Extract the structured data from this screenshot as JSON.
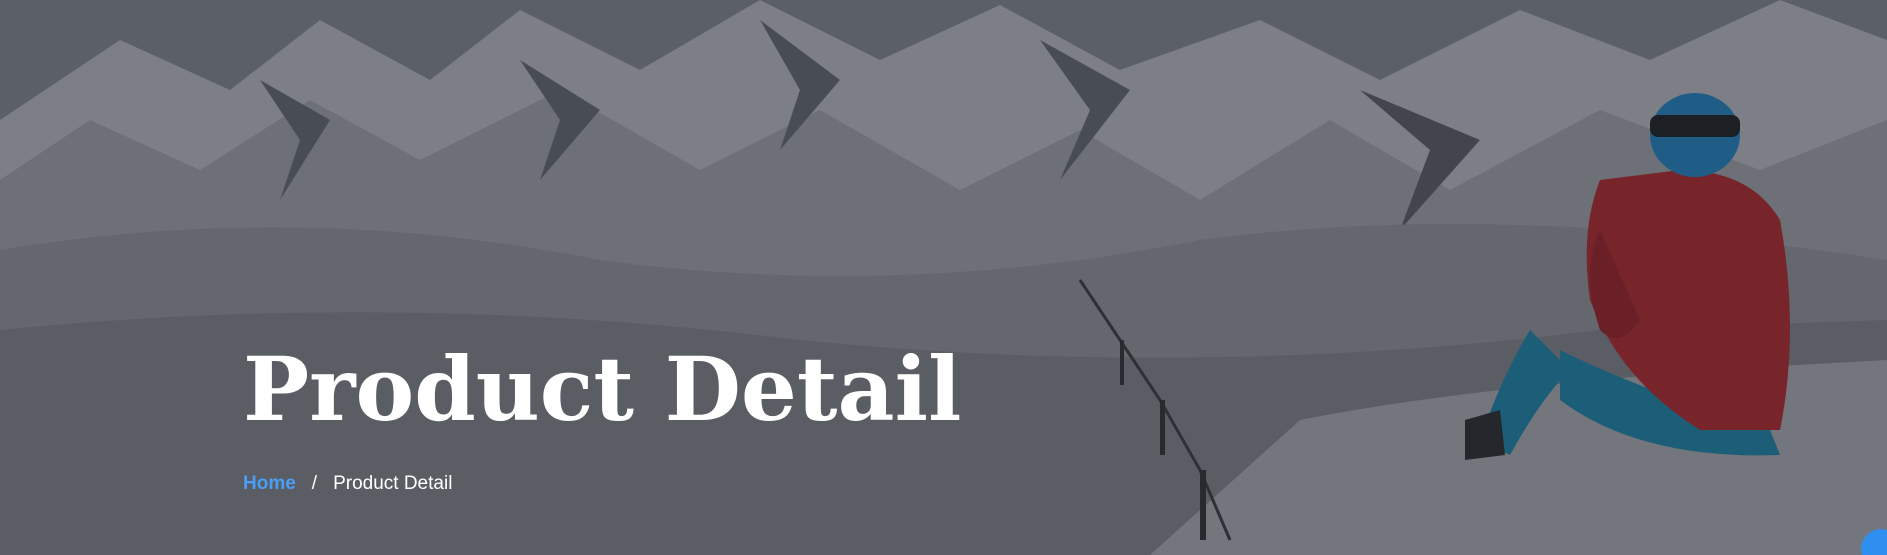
{
  "hero": {
    "title": "Product Detail",
    "breadcrumb": {
      "home_label": "Home",
      "separator": "/",
      "current_label": "Product Detail"
    }
  },
  "colors": {
    "breadcrumb_link": "#4a9ff5",
    "title_text": "#ffffff",
    "overlay": "#1e2228",
    "jacket": "#c0282e",
    "helmet": "#1f8fd6",
    "pants": "#1a8fb8"
  },
  "icons": {
    "background": "snowy-mountain-skier-photo"
  }
}
